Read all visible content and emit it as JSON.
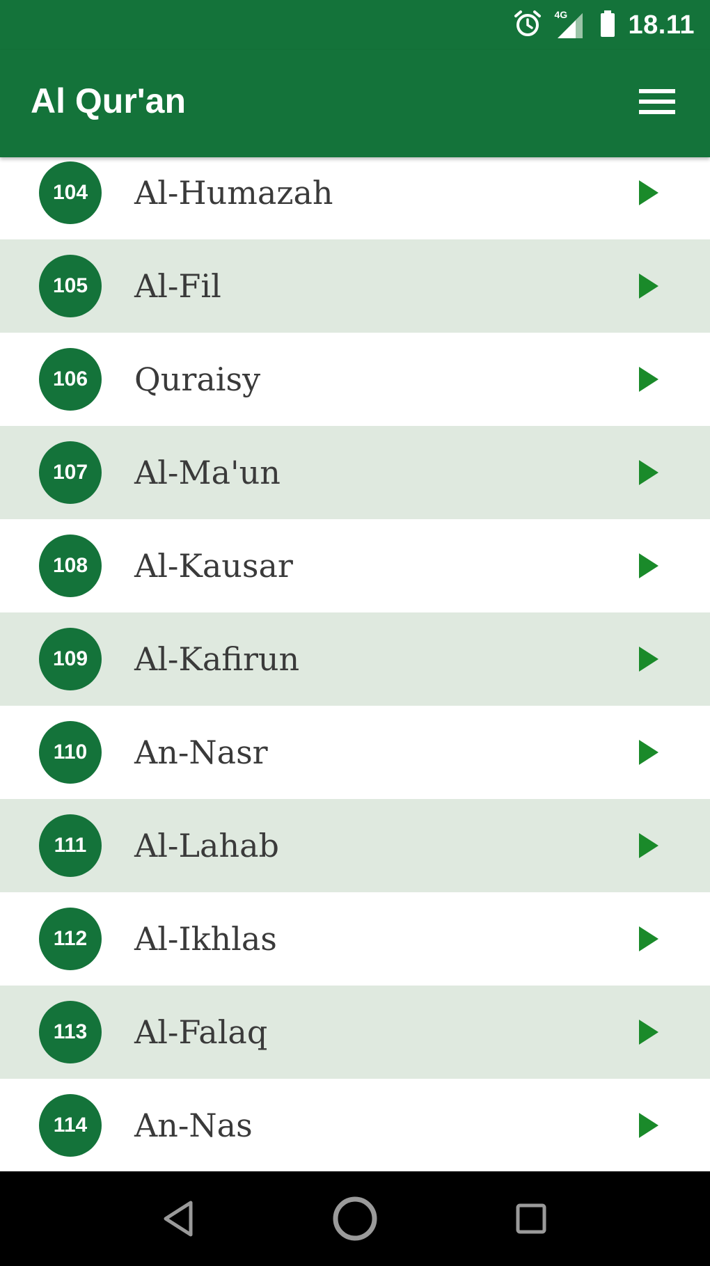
{
  "status_bar": {
    "time": "18.11",
    "network": "4G",
    "icons": [
      "alarm-icon",
      "signal-icon",
      "battery-icon"
    ]
  },
  "app_bar": {
    "title": "Al Qur'an",
    "menu_icon": "hamburger-menu-icon"
  },
  "surah_list": {
    "items": [
      {
        "number": "104",
        "name": "Al-Humazah"
      },
      {
        "number": "105",
        "name": "Al-Fil"
      },
      {
        "number": "106",
        "name": "Quraisy"
      },
      {
        "number": "107",
        "name": "Al-Ma'un"
      },
      {
        "number": "108",
        "name": "Al-Kausar"
      },
      {
        "number": "109",
        "name": "Al-Kafirun"
      },
      {
        "number": "110",
        "name": "An-Nasr"
      },
      {
        "number": "111",
        "name": "Al-Lahab"
      },
      {
        "number": "112",
        "name": "Al-Ikhlas"
      },
      {
        "number": "113",
        "name": "Al-Falaq"
      },
      {
        "number": "114",
        "name": "An-Nas"
      }
    ],
    "play_icon": "play-icon"
  },
  "nav_bar": {
    "icons": [
      "back-icon",
      "home-icon",
      "recents-icon"
    ]
  },
  "colors": {
    "primary": "#14733a",
    "row_alt": "#dfe9df",
    "play": "#1a8a2a",
    "text": "#3a3a3a"
  }
}
